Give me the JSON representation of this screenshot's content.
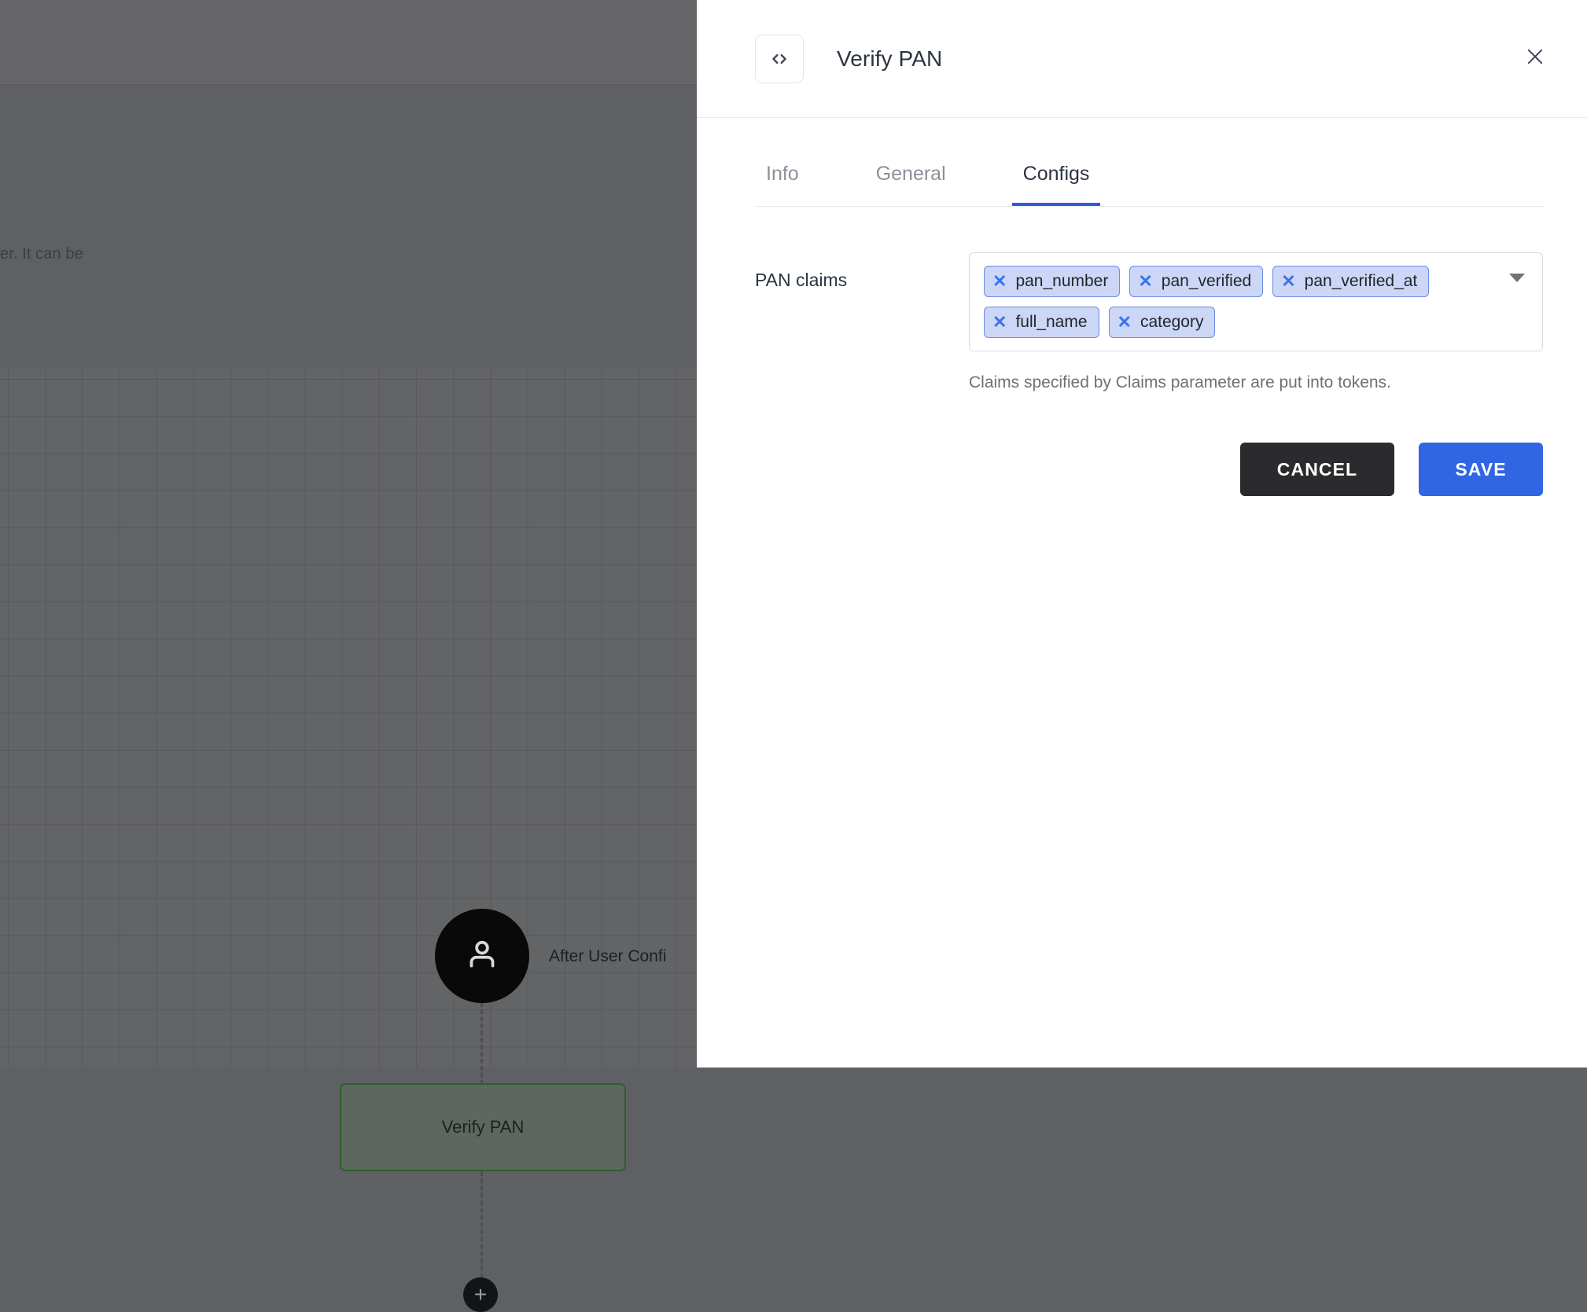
{
  "background": {
    "description_fragment": "er. It can be",
    "nodes": {
      "user_node_label": "After User Confi",
      "user_icon": "user-icon",
      "flow_node_label": "Verify PAN",
      "add_button_label": "+"
    }
  },
  "drawer": {
    "icon": "code-brackets-icon",
    "title": "Verify PAN",
    "close_icon": "close-icon",
    "tabs": [
      {
        "label": "Info",
        "active": false
      },
      {
        "label": "General",
        "active": false
      },
      {
        "label": "Configs",
        "active": true
      }
    ],
    "form": {
      "claims_label": "PAN claims",
      "chips": [
        "pan_number",
        "pan_verified",
        "pan_verified_at",
        "full_name",
        "category"
      ],
      "chip_remove_icon": "✕",
      "dropdown_icon": "chevron-down-icon",
      "helper_text": "Claims specified by Claims parameter are put into tokens."
    },
    "actions": {
      "cancel_label": "CANCEL",
      "save_label": "SAVE"
    }
  },
  "colors": {
    "accent_blue": "#3066e3",
    "tab_active_underline": "#2f5bd9",
    "chip_bg": "#ccd6f6",
    "chip_border": "#6d8ce4",
    "chip_x": "#3b74e8",
    "cancel_bg": "#2b2b2d",
    "node_border_green": "#2f5f2f",
    "overlay_gray": "#5e6063"
  }
}
